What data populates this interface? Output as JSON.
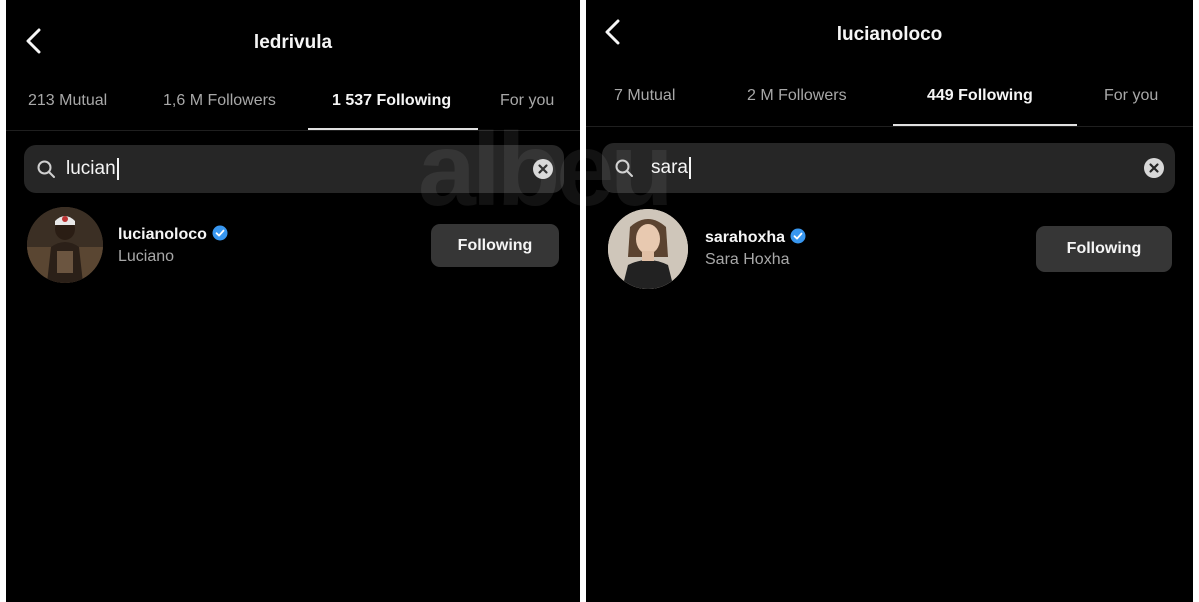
{
  "screens": [
    {
      "title": "ledrivula",
      "tabs": [
        {
          "label": "213 Mutual"
        },
        {
          "label": "1,6 M Followers"
        },
        {
          "label": "1 537 Following"
        },
        {
          "label": "For you"
        }
      ],
      "active_tab": 2,
      "search": {
        "value": "lucian"
      },
      "result": {
        "username": "lucianoloco",
        "full_name": "Luciano",
        "verified": true,
        "button_label": "Following"
      }
    },
    {
      "title": "lucianoloco",
      "tabs": [
        {
          "label": "7 Mutual"
        },
        {
          "label": "2 M Followers"
        },
        {
          "label": "449 Following"
        },
        {
          "label": "For you"
        }
      ],
      "active_tab": 2,
      "search": {
        "value": "sara"
      },
      "result": {
        "username": "sarahoxha",
        "full_name": "Sara Hoxha",
        "verified": true,
        "button_label": "Following"
      }
    }
  ],
  "watermark": "albeu",
  "icons": {
    "back": "chevron-left-icon",
    "search": "search-icon",
    "clear": "clear-circle-icon",
    "verified": "verified-badge-icon"
  },
  "colors": {
    "background": "#000000",
    "search_bg": "#262626",
    "button_bg": "#363636",
    "verified": "#3897f0",
    "muted_text": "#a8a8a8"
  }
}
